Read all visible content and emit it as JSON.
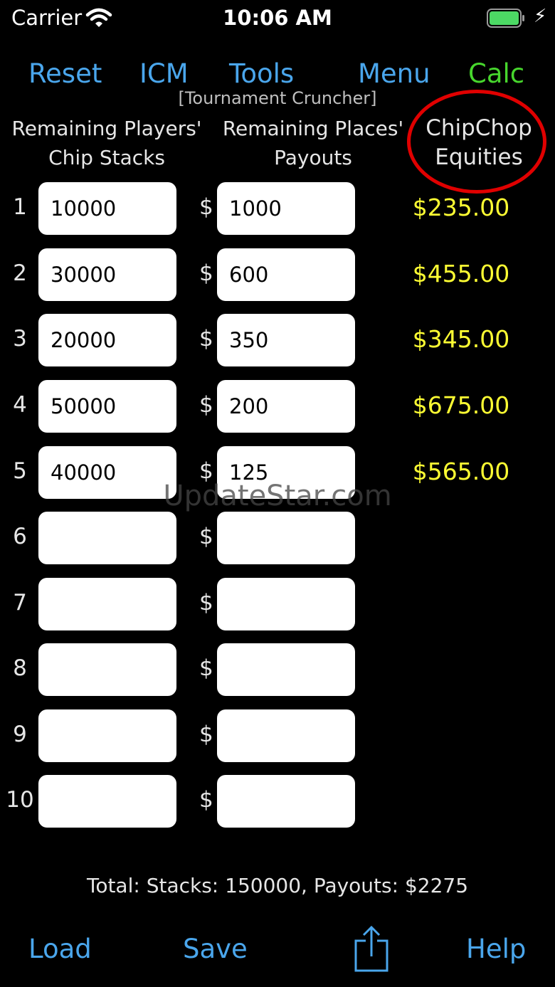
{
  "status": {
    "carrier": "Carrier",
    "time": "10:06 AM"
  },
  "nav": {
    "reset": "Reset",
    "icm": "ICM",
    "tools": "Tools",
    "menu": "Menu",
    "calc": "Calc"
  },
  "subtitle": "[Tournament Cruncher]",
  "headers": {
    "stacks_line1": "Remaining Players'",
    "stacks_line2": "Chip Stacks",
    "payouts_line1": "Remaining Places'",
    "payouts_line2": "Payouts",
    "equity_line1": "ChipChop",
    "equity_line2": "Equities"
  },
  "currency": "$",
  "rows": [
    {
      "num": "1",
      "stack": "10000",
      "payout": "1000",
      "equity": "$235.00"
    },
    {
      "num": "2",
      "stack": "30000",
      "payout": "600",
      "equity": "$455.00"
    },
    {
      "num": "3",
      "stack": "20000",
      "payout": "350",
      "equity": "$345.00"
    },
    {
      "num": "4",
      "stack": "50000",
      "payout": "200",
      "equity": "$675.00"
    },
    {
      "num": "5",
      "stack": "40000",
      "payout": "125",
      "equity": "$565.00"
    },
    {
      "num": "6",
      "stack": "",
      "payout": "",
      "equity": ""
    },
    {
      "num": "7",
      "stack": "",
      "payout": "",
      "equity": ""
    },
    {
      "num": "8",
      "stack": "",
      "payout": "",
      "equity": ""
    },
    {
      "num": "9",
      "stack": "",
      "payout": "",
      "equity": ""
    },
    {
      "num": "10",
      "stack": "",
      "payout": "",
      "equity": ""
    }
  ],
  "watermark": "UpdateStar.com",
  "total": "Total: Stacks: 150000, Payouts: $2275",
  "bottom": {
    "load": "Load",
    "save": "Save",
    "share_icon": "share-icon",
    "help": "Help"
  },
  "colors": {
    "link": "#4aa6ec",
    "calc": "#47d62d",
    "equity": "#ffff33",
    "highlight_circle": "#e00000"
  }
}
